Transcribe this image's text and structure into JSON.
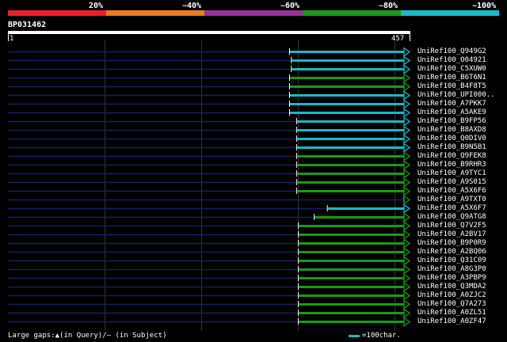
{
  "identity_legend": [
    {
      "label": "20%",
      "color": "#e8202a",
      "from": 0,
      "to": 20
    },
    {
      "label": "~40%",
      "color": "#ef7a1a",
      "from": 20,
      "to": 40
    },
    {
      "label": "~60%",
      "color": "#9b2f9b",
      "from": 40,
      "to": 60
    },
    {
      "label": "~80%",
      "color": "#1a9a1a",
      "from": 60,
      "to": 80
    },
    {
      "label": "~100%",
      "color": "#19b9c6",
      "from": 80,
      "to": 100
    }
  ],
  "query": {
    "name": "BP031462",
    "start": "1",
    "end": "457",
    "length": 457
  },
  "colors": {
    "identity_high": "#19b9c6",
    "identity_mid": "#1a9a1a",
    "gap_line": "#16205a",
    "grid": "#333333"
  },
  "hits": [
    {
      "name": "UniRef100_Q949G2",
      "start": 320,
      "identity": "high"
    },
    {
      "name": "UniRef100_O04921",
      "start": 322,
      "identity": "high"
    },
    {
      "name": "UniRef100_C5XUW0",
      "start": 322,
      "identity": "high"
    },
    {
      "name": "UniRef100_B6T6N1",
      "start": 320,
      "identity": "mid"
    },
    {
      "name": "UniRef100_B4F8T5",
      "start": 320,
      "identity": "mid"
    },
    {
      "name": "UniRef100_UPI000..",
      "start": 320,
      "identity": "high"
    },
    {
      "name": "UniRef100_A7PKK7",
      "start": 320,
      "identity": "high"
    },
    {
      "name": "UniRef100_A5AKE9",
      "start": 320,
      "identity": "high"
    },
    {
      "name": "UniRef100_B9FP56",
      "start": 328,
      "identity": "high"
    },
    {
      "name": "UniRef100_B8AXD8",
      "start": 328,
      "identity": "high"
    },
    {
      "name": "UniRef100_Q0DIV0",
      "start": 328,
      "identity": "high"
    },
    {
      "name": "UniRef100_B9N5B1",
      "start": 328,
      "identity": "high"
    },
    {
      "name": "UniRef100_Q9FEK8",
      "start": 328,
      "identity": "mid"
    },
    {
      "name": "UniRef100_B9RHR3",
      "start": 328,
      "identity": "mid"
    },
    {
      "name": "UniRef100_A9TYC1",
      "start": 328,
      "identity": "mid"
    },
    {
      "name": "UniRef100_A9S015",
      "start": 328,
      "identity": "mid"
    },
    {
      "name": "UniRef100_A5X6F6",
      "start": 328,
      "identity": "mid"
    },
    {
      "name": "UniRef100_A9TXT0",
      "start": 450,
      "identity": "mid"
    },
    {
      "name": "UniRef100_A5X6F7",
      "start": 363,
      "identity": "high"
    },
    {
      "name": "UniRef100_Q9ATG8",
      "start": 348,
      "identity": "mid"
    },
    {
      "name": "UniRef100_Q7V2F5",
      "start": 330,
      "identity": "mid"
    },
    {
      "name": "UniRef100_A2BV17",
      "start": 330,
      "identity": "mid"
    },
    {
      "name": "UniRef100_B9P0R9",
      "start": 330,
      "identity": "mid"
    },
    {
      "name": "UniRef100_A2BQ06",
      "start": 330,
      "identity": "mid"
    },
    {
      "name": "UniRef100_Q31C09",
      "start": 330,
      "identity": "mid"
    },
    {
      "name": "UniRef100_A8G3P0",
      "start": 330,
      "identity": "mid"
    },
    {
      "name": "UniRef100_A3PBP9",
      "start": 330,
      "identity": "mid"
    },
    {
      "name": "UniRef100_Q3MDA2",
      "start": 330,
      "identity": "mid"
    },
    {
      "name": "UniRef100_A0ZJC2",
      "start": 330,
      "identity": "mid"
    },
    {
      "name": "UniRef100_Q7A273",
      "start": 330,
      "identity": "mid"
    },
    {
      "name": "UniRef100_A0ZL51",
      "start": 330,
      "identity": "mid"
    },
    {
      "name": "UniRef100_A0ZF47",
      "start": 330,
      "identity": "mid"
    }
  ],
  "footer": {
    "gaps_text": "Large gaps:▲(in Query)/– (in Subject)",
    "scale_text": "=100char.",
    "scale_color": "#19b9c6"
  }
}
